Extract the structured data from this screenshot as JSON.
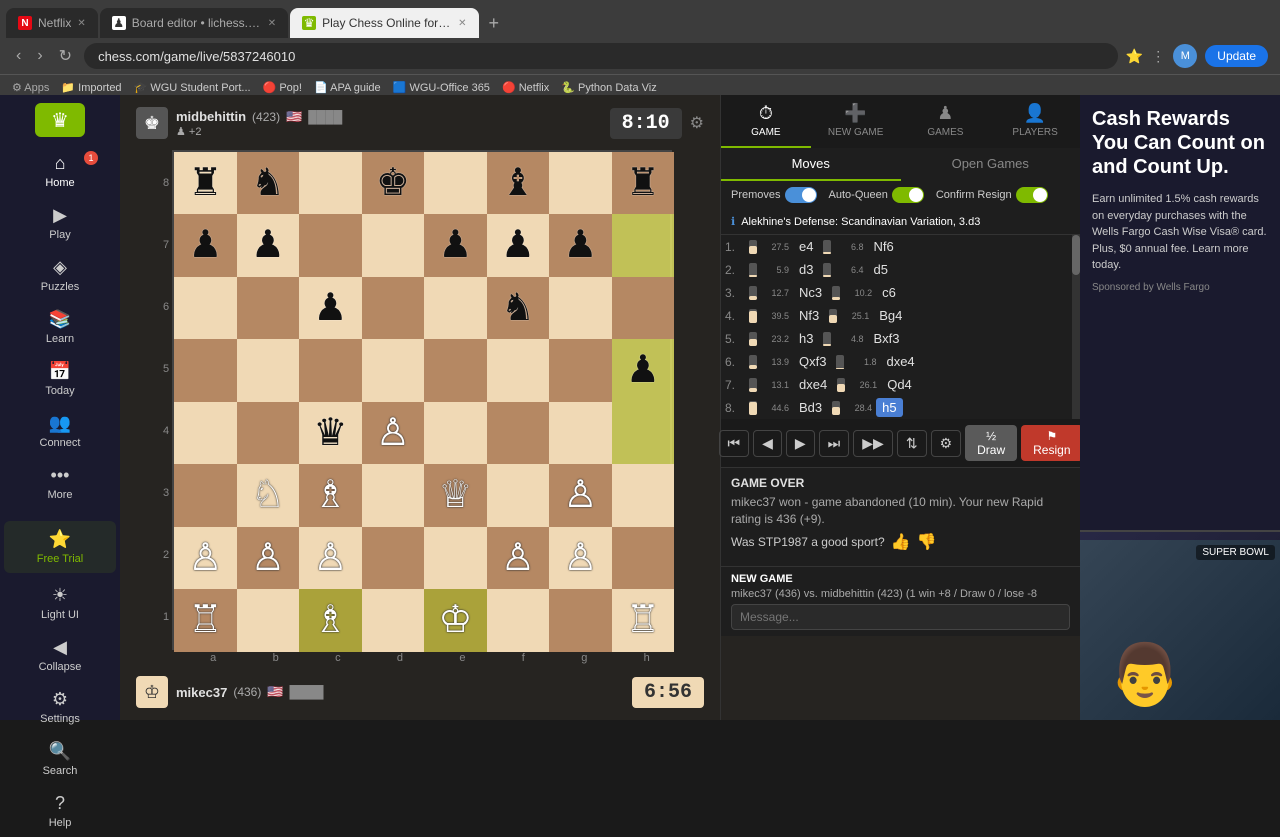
{
  "browser": {
    "tabs": [
      {
        "label": "Netflix",
        "favicon": "N",
        "active": false,
        "url": ""
      },
      {
        "label": "Board editor • lichess.org",
        "favicon": "♟",
        "active": false,
        "url": ""
      },
      {
        "label": "Play Chess Online for FREE",
        "favicon": "♛",
        "active": true,
        "url": "chess.com/game/live/5837246010"
      }
    ],
    "address": "chess.com/game/live/5837246010",
    "bookmarks": [
      "Imported",
      "WGU Student Port...",
      "Pop!",
      "APA guide",
      "WGU-Office 365",
      "Netflix",
      "Python Data Viz"
    ],
    "update_label": "Update"
  },
  "sidebar": {
    "logo_text": "Chess.com",
    "items": [
      {
        "label": "Home",
        "icon": "⌂",
        "badge": "1"
      },
      {
        "label": "Play",
        "icon": "▶"
      },
      {
        "label": "Puzzles",
        "icon": "◈"
      },
      {
        "label": "Learn",
        "icon": "📚"
      },
      {
        "label": "Today",
        "icon": "📅"
      },
      {
        "label": "Connect",
        "icon": "👥"
      },
      {
        "label": "More",
        "icon": "•••"
      }
    ],
    "bottom_items": [
      {
        "label": "Light UI",
        "icon": "☀"
      },
      {
        "label": "Collapse",
        "icon": "◀"
      },
      {
        "label": "Settings",
        "icon": "⚙"
      },
      {
        "label": "Search",
        "icon": "🔍"
      },
      {
        "label": "Help",
        "icon": "?"
      }
    ],
    "free_trial_label": "Free Trial"
  },
  "game": {
    "top_player": {
      "name": "midbehittin",
      "rating": "423",
      "flag": "🇺🇸",
      "timer": "8:10",
      "pieces_up": "+2"
    },
    "bottom_player": {
      "name": "mikec37",
      "rating": "436",
      "flag": "🇺🇸",
      "timer": "6:56"
    },
    "opening": "Alekhine's Defense: Scandinavian Variation, 3.d3",
    "moves": [
      {
        "num": 1,
        "white": "e4",
        "black": "Nf6",
        "eval_w": "27.5",
        "eval_b": "6.8"
      },
      {
        "num": 2,
        "white": "d3",
        "black": "d5",
        "eval_w": "5.9",
        "eval_b": "6.4"
      },
      {
        "num": 3,
        "white": "Nc3",
        "black": "c6",
        "eval_w": "12.7",
        "eval_b": "10.2"
      },
      {
        "num": 4,
        "white": "Nf3",
        "black": "Bg4",
        "eval_w": "39.5",
        "eval_b": "25.1"
      },
      {
        "num": 5,
        "white": "h3",
        "black": "Bxf3",
        "eval_w": "23.2",
        "eval_b": "4.8"
      },
      {
        "num": 6,
        "white": "Qxf3",
        "black": "dxe4",
        "eval_w": "13.9",
        "eval_b": "1.8"
      },
      {
        "num": 7,
        "white": "dxe4",
        "black": "Qd4",
        "eval_w": "13.1",
        "eval_b": "26.1"
      },
      {
        "num": 8,
        "white": "Bd3",
        "black": "h5",
        "eval_w": "44.6",
        "eval_b": "28.4",
        "last": true
      }
    ],
    "toggles": {
      "premoves": true,
      "auto_queen": true,
      "confirm_resign": true
    },
    "controls": [
      "⏮",
      "◀",
      "▶",
      "⏭",
      "▷▷",
      "📋",
      "⚙"
    ],
    "draw_label": "Draw",
    "resign_label": "Resign"
  },
  "game_result": {
    "title": "GAME OVER",
    "description": "mikec37 won - game abandoned (10 min). Your new Rapid rating is 436 (+9).",
    "sport_question": "Was STP1987 a good sport?",
    "new_game_title": "NEW GAME",
    "new_game_desc": "mikec37 (436) vs. midbehittin (423) (1 win +8 / Draw 0 / lose -8",
    "message_placeholder": "Message..."
  },
  "nav_tabs": [
    {
      "label": "GAME",
      "icon": "⏱",
      "active": true
    },
    {
      "label": "NEW GAME",
      "icon": "➕"
    },
    {
      "label": "GAMES",
      "icon": "♟"
    },
    {
      "label": "PLAYERS",
      "icon": "👤"
    }
  ],
  "moves_tabs": [
    {
      "label": "Moves",
      "active": true
    },
    {
      "label": "Open Games",
      "active": false
    }
  ],
  "ad": {
    "headline": "Cash Rewards You Can Count on and Count Up.",
    "body": "Earn unlimited 1.5% cash rewards on everyday purchases with the Wells Fargo Cash Wise Visa® card. Plus, $0 annual fee. Learn more today.",
    "sponsor": "Sponsored by Wells Fargo"
  },
  "board": {
    "rank_labels": [
      "8",
      "7",
      "6",
      "5",
      "4",
      "3",
      "2",
      "1"
    ],
    "file_labels": [
      "a",
      "b",
      "c",
      "d",
      "e",
      "f",
      "g",
      "h"
    ]
  }
}
